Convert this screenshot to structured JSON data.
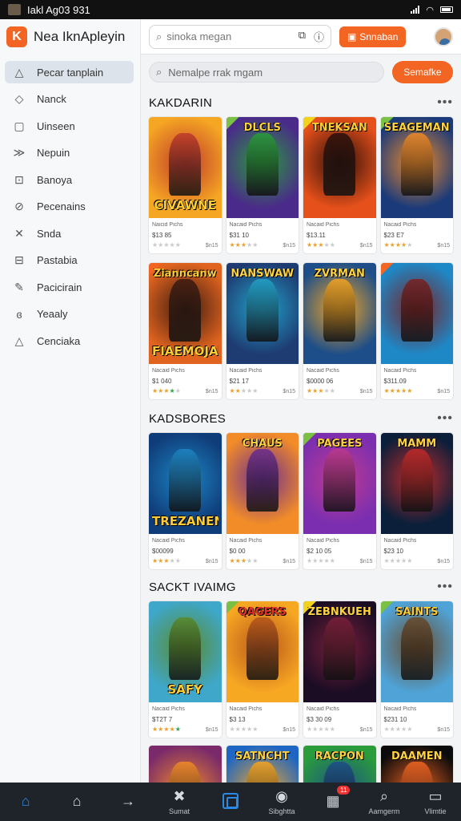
{
  "statusbar": {
    "text": "Iakl Ag03 931"
  },
  "app": {
    "title": "Nea IknApleyin",
    "logo_letter": "K"
  },
  "sidebar": {
    "items": [
      {
        "label": "Pecar tanplain",
        "icon": "triangle-icon",
        "glyph": "△",
        "active": true
      },
      {
        "label": "Nanck",
        "icon": "diamond-outline-icon",
        "glyph": "◇"
      },
      {
        "label": "Uinseen",
        "icon": "square-icon",
        "glyph": "▢"
      },
      {
        "label": "Nepuin",
        "icon": "chevron-lines-icon",
        "glyph": "≫"
      },
      {
        "label": "Banoya",
        "icon": "bag-icon",
        "glyph": "⊡"
      },
      {
        "label": "Pecenains",
        "icon": "slash-circle-icon",
        "glyph": "⊘"
      },
      {
        "label": "Snda",
        "icon": "cross-icon",
        "glyph": "✕"
      },
      {
        "label": "Pastabia",
        "icon": "tag-icon",
        "glyph": "⊟"
      },
      {
        "label": "Pacicirain",
        "icon": "pen-icon",
        "glyph": "✎"
      },
      {
        "label": "Yeaaly",
        "icon": "spiral-icon",
        "glyph": "ɞ"
      },
      {
        "label": "Cenciaka",
        "icon": "triangle-icon",
        "glyph": "△"
      }
    ]
  },
  "header": {
    "search_placeholder": "sinoka megan",
    "button_label": "Snnaban"
  },
  "main": {
    "search_placeholder": "Nemalpe rrak mgam",
    "search_button": "Semafke"
  },
  "sections": [
    {
      "title": "KAKDARIN",
      "cards": [
        {
          "top": "",
          "bottom": "CIVAWNE",
          "pub": "Naicid Pichs",
          "price": "$13 85",
          "size": "$n15",
          "stars": [
            0,
            0,
            0,
            0,
            0
          ],
          "colors": [
            "#f5a623",
            "#c0392b"
          ],
          "title_color": "#ffcc33",
          "ribbon": ""
        },
        {
          "top": "DLCLS",
          "bottom": "",
          "pub": "Nacaid Pichs",
          "price": "$31 10",
          "size": "$n15",
          "stars": [
            1,
            1,
            1,
            0,
            0
          ],
          "colors": [
            "#4a2a8a",
            "#2a9d3a"
          ],
          "title_color": "#ffd23f",
          "ribbon": "#7ac043"
        },
        {
          "top": "TNEKSAN",
          "bottom": "",
          "pub": "Nacaid Pichs",
          "price": "$13.11",
          "size": "$n15",
          "stars": [
            1,
            1,
            1,
            0,
            0
          ],
          "colors": [
            "#e6501a",
            "#2b0f0a"
          ],
          "title_color": "#ffcc33",
          "ribbon": "#f2d21b"
        },
        {
          "top": "SEAGEMAN",
          "bottom": "",
          "pub": "Nacaid Pichs",
          "price": "$23 E7",
          "size": "$n15",
          "stars": [
            1,
            1,
            1,
            1,
            0
          ],
          "colors": [
            "#1a3a7a",
            "#f28c28"
          ],
          "title_color": "#ffd23f",
          "ribbon": "#7ac043"
        }
      ]
    },
    {
      "title": "",
      "cards": [
        {
          "top": "Zianncanw",
          "bottom": "FIAEMOJAN",
          "pub": "Nacaid Pichs",
          "price": "$1 040",
          "size": "$n15",
          "stars": [
            1,
            1,
            1,
            2,
            0
          ],
          "colors": [
            "#e0641f",
            "#3b1a10"
          ],
          "title_color": "#ffcc33",
          "ribbon": "#f26522"
        },
        {
          "top": "NANSWAW",
          "bottom": "",
          "pub": "Nacaid Pichs",
          "price": "$21 17",
          "size": "$n15",
          "stars": [
            1,
            1,
            0,
            0,
            0
          ],
          "colors": [
            "#1e3c72",
            "#22a3c9"
          ],
          "title_color": "#ffd23f",
          "ribbon": ""
        },
        {
          "top": "ZVRMAN",
          "bottom": "",
          "pub": "Nacaid Pichs",
          "price": "$0000 06",
          "size": "$n15",
          "stars": [
            1,
            1,
            1,
            0,
            0
          ],
          "colors": [
            "#1d4e89",
            "#f5a623"
          ],
          "title_color": "#ffd23f",
          "ribbon": ""
        },
        {
          "top": "",
          "bottom": "",
          "pub": "Nacaid Pichs",
          "price": "$311.09",
          "size": "$n15",
          "stars": [
            1,
            1,
            1,
            1,
            1
          ],
          "colors": [
            "#1e88c7",
            "#7a2020"
          ],
          "title_color": "#ffffff",
          "ribbon": "#f26522"
        }
      ]
    },
    {
      "title": "KADSBORES",
      "cards": [
        {
          "top": "",
          "bottom": "TREZANEN",
          "pub": "Nacaid Pichs",
          "price": "$00099",
          "size": "$n15",
          "stars": [
            1,
            1,
            1,
            0,
            0
          ],
          "colors": [
            "#0f3d7a",
            "#1d86c4"
          ],
          "title_color": "#ffcc33",
          "ribbon": ""
        },
        {
          "top": "CHAUS",
          "bottom": "",
          "pub": "Nacaid Pichs",
          "price": "$0 00",
          "size": "$n15",
          "stars": [
            1,
            1,
            1,
            0,
            0
          ],
          "colors": [
            "#f28c28",
            "#6a2c91"
          ],
          "title_color": "#ffd23f",
          "ribbon": ""
        },
        {
          "top": "PAGEES",
          "bottom": "",
          "pub": "Nacaid Pichs",
          "price": "$2 10 05",
          "size": "$n15",
          "stars": [
            0,
            0,
            0,
            0,
            0
          ],
          "colors": [
            "#7b2fb0",
            "#c03a8f"
          ],
          "title_color": "#ffd23f",
          "ribbon": "#7ac043"
        },
        {
          "top": "MAMM",
          "bottom": "",
          "pub": "Nacaid Pichs",
          "price": "$23 10",
          "size": "$n15",
          "stars": [
            0,
            0,
            0,
            0,
            0
          ],
          "colors": [
            "#0b1f3a",
            "#c42a2a"
          ],
          "title_color": "#ffd23f",
          "ribbon": ""
        }
      ]
    },
    {
      "title": "SACKT IVAIMG",
      "cards": [
        {
          "top": "",
          "bottom": "SAFY",
          "pub": "Nacaid Pichs",
          "price": "$T2T 7",
          "size": "$n15",
          "stars": [
            1,
            1,
            1,
            1,
            2
          ],
          "colors": [
            "#3fa7c9",
            "#5a8a2a"
          ],
          "title_color": "#ffcc33",
          "ribbon": ""
        },
        {
          "top": "QAGERS",
          "bottom": "",
          "pub": "Nacaid Pichs",
          "price": "$3 13",
          "size": "$n15",
          "stars": [
            0,
            0,
            0,
            0,
            0
          ],
          "colors": [
            "#f7a823",
            "#b8541a"
          ],
          "title_color": "#e63329",
          "ribbon": "#7ac043"
        },
        {
          "top": "ZEBNKUEH",
          "bottom": "",
          "pub": "Nacaid Pichs",
          "price": "$3 30 09",
          "size": "$n15",
          "stars": [
            0,
            0,
            0,
            0,
            0
          ],
          "colors": [
            "#1b0d24",
            "#7a1f3a"
          ],
          "title_color": "#ffd23f",
          "ribbon": "#f2d21b"
        },
        {
          "top": "SAINTS",
          "bottom": "",
          "pub": "Nacaid Pichs",
          "price": "$231 10",
          "size": "$n15",
          "stars": [
            0,
            0,
            0,
            0,
            0
          ],
          "colors": [
            "#4fa3d6",
            "#6a4a2a"
          ],
          "title_color": "#ffcc33",
          "ribbon": "#7ac043"
        }
      ]
    },
    {
      "title": "",
      "cards": [
        {
          "top": "",
          "bottom": "",
          "pub": "",
          "price": "",
          "size": "",
          "stars": [],
          "colors": [
            "#7a2a6a",
            "#f28c28"
          ],
          "title_color": "#ffcc33",
          "ribbon": ""
        },
        {
          "top": "SATNCHT",
          "bottom": "",
          "pub": "",
          "price": "",
          "size": "",
          "stars": [],
          "colors": [
            "#1d66c4",
            "#f5a623"
          ],
          "title_color": "#ffd23f",
          "ribbon": ""
        },
        {
          "top": "RACPON",
          "bottom": "",
          "pub": "",
          "price": "",
          "size": "",
          "stars": [],
          "colors": [
            "#2a9d3a",
            "#1d4e89"
          ],
          "title_color": "#ffd23f",
          "ribbon": ""
        },
        {
          "top": "DAAMEN",
          "bottom": "",
          "pub": "",
          "price": "",
          "size": "",
          "stars": [],
          "colors": [
            "#0b0b0b",
            "#f26522"
          ],
          "title_color": "#ffd23f",
          "ribbon": ""
        }
      ]
    }
  ],
  "bottomnav": {
    "items": [
      {
        "label": "",
        "icon": "home-icon",
        "glyph": "⌂",
        "active": true
      },
      {
        "label": "",
        "icon": "house-outline-icon",
        "glyph": "⌂"
      },
      {
        "label": "",
        "icon": "arrow-right-icon",
        "glyph": "→"
      },
      {
        "label": "Sumat",
        "icon": "cross-icon",
        "glyph": "✖"
      },
      {
        "label": "",
        "icon": "store-square-icon",
        "glyph": ""
      },
      {
        "label": "Sibghtta",
        "icon": "compass-icon",
        "glyph": "◉"
      },
      {
        "label": "",
        "icon": "grid-icon",
        "glyph": "▦",
        "badge": "11"
      },
      {
        "label": "Aamgerm",
        "icon": "search-icon",
        "glyph": "⌕"
      },
      {
        "label": "Vlimtie",
        "icon": "monitor-icon",
        "glyph": "▭"
      }
    ]
  }
}
